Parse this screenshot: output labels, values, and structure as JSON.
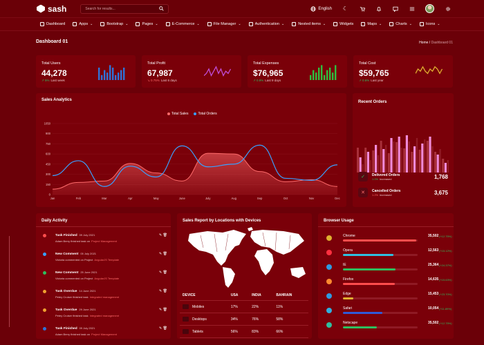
{
  "brand": "sash",
  "search": {
    "placeholder": "Search for results..."
  },
  "topbar": {
    "language": "English"
  },
  "nav": [
    {
      "label": "Dashboard",
      "caret": false
    },
    {
      "label": "Apps",
      "caret": true
    },
    {
      "label": "Bootstrap",
      "caret": true
    },
    {
      "label": "Pages",
      "caret": true
    },
    {
      "label": "E-Commerce",
      "caret": true
    },
    {
      "label": "File Manager",
      "caret": true
    },
    {
      "label": "Authentication",
      "caret": true
    },
    {
      "label": "Nested items",
      "caret": true
    },
    {
      "label": "Widgets",
      "caret": false
    },
    {
      "label": "Maps",
      "caret": true
    },
    {
      "label": "Charts",
      "caret": true
    },
    {
      "label": "Icons",
      "caret": true
    }
  ],
  "page": {
    "title": "Dashboard 01",
    "crumb_home": "Home",
    "crumb_current": "Dashboard 01"
  },
  "stats": [
    {
      "title": "Total Users",
      "value": "44,278",
      "change": "5%",
      "period": "Last week",
      "trend": "up",
      "color": "#2f72d8"
    },
    {
      "title": "Total Profit",
      "value": "67,987",
      "change": "0.75%",
      "period": "Last 6 days",
      "trend": "down",
      "color": "#c04dd8"
    },
    {
      "title": "Total Expenses",
      "value": "$76,965",
      "change": "0.9%",
      "period": "Last 9 days",
      "trend": "up",
      "color": "#2fbf3f"
    },
    {
      "title": "Total Cost",
      "value": "$59,765",
      "change": "0.6%",
      "period": "Last year",
      "trend": "up",
      "color": "#e0b030"
    }
  ],
  "sales_analytics": {
    "title": "Sales Analytics",
    "legend": [
      {
        "name": "Total Sales",
        "color": "#ff6b6b"
      },
      {
        "name": "Total Orders",
        "color": "#3aa0ff"
      }
    ]
  },
  "chart_data": {
    "type": "area",
    "categories": [
      "Jan",
      "Feb",
      "Mar",
      "Apr",
      "May",
      "June",
      "July",
      "Aug",
      "Sep",
      "Oct",
      "Nov",
      "Dec"
    ],
    "ylim": [
      0,
      1000
    ],
    "yticks": [
      0,
      150,
      300,
      450,
      600,
      750,
      900,
      1050
    ],
    "series": [
      {
        "name": "Total Sales",
        "color": "#ff6b6b",
        "values": [
          80,
          180,
          200,
          460,
          320,
          200,
          610,
          600,
          340,
          190,
          220,
          120
        ]
      },
      {
        "name": "Total Orders",
        "color": "#3aa0ff",
        "values": [
          280,
          500,
          120,
          420,
          260,
          720,
          410,
          450,
          730,
          240,
          210,
          440
        ]
      }
    ]
  },
  "recent_orders": {
    "title": "Recent Orders",
    "items": [
      {
        "title": "Delivered Orders",
        "change": "1.0%",
        "note": "increased",
        "value": "1,768",
        "icon": "✓",
        "color": "#2fbf5f"
      },
      {
        "title": "Cancelled Orders",
        "change": "1.2%",
        "note": "increased",
        "value": "3,675",
        "icon": "✕",
        "color": "#ff6b6b"
      }
    ]
  },
  "daily_activity": {
    "title": "Daily Activity",
    "items": [
      {
        "title": "Task Finished",
        "date": "09 July 2021",
        "desc": "Adam Berry finished task on",
        "link": "Project Management",
        "color": "#ff4d4d"
      },
      {
        "title": "New Comment",
        "date": "05 July 2021",
        "desc": "Victoria commented on Project",
        "link": "AngularJS Template",
        "color": "#3aa0ff"
      },
      {
        "title": "New Comment",
        "date": "25 June 2021",
        "desc": "Victoria commented on Project",
        "link": "AngularJS Template",
        "color": "#2fbf5f"
      },
      {
        "title": "Task Overdue",
        "date": "14 June 2021",
        "desc": "Petey Cruiser finished task",
        "link": "Integrated management",
        "color": "#f0a030"
      },
      {
        "title": "Task Overdue",
        "date": "29 June 2021",
        "desc": "Petey Cruiser finished task",
        "link": "Integrated management",
        "color": "#f0a030"
      },
      {
        "title": "Task Finished",
        "date": "09 July 2021",
        "desc": "Adam Berry finished task on",
        "link": "Project Management",
        "color": "#2f72d8"
      }
    ]
  },
  "sales_report": {
    "title": "Sales Report by Locations with Devices",
    "columns": [
      "DEVICE",
      "USA",
      "INDIA",
      "BAHRAIN"
    ],
    "rows": [
      {
        "device": "Mobiles",
        "usa": "17%",
        "india": "22%",
        "bahrain": "11%"
      },
      {
        "device": "Desktops",
        "usa": "34%",
        "india": "76%",
        "bahrain": "58%"
      },
      {
        "device": "Tablets",
        "usa": "56%",
        "india": "83%",
        "bahrain": "66%"
      }
    ]
  },
  "browser_usage": {
    "title": "Browser Usage",
    "items": [
      {
        "name": "Chrome",
        "value": "35,502",
        "pct": "(+12.75%)",
        "share": 0.98,
        "color": "#ff4d4d",
        "icon": "#e0b030"
      },
      {
        "name": "Opera",
        "value": "12,563",
        "pct": "(+15.12%)",
        "share": 0.68,
        "color": "#2fbfe0",
        "icon": "#ff3040"
      },
      {
        "name": "IE",
        "value": "25,364",
        "pct": "(+24.37%)",
        "share": 0.7,
        "color": "#2fbf5f",
        "icon": "#2f9ae0"
      },
      {
        "name": "Firefox",
        "value": "14,635",
        "pct": "(+15.63%)",
        "share": 0.69,
        "color": "#ff4d4d",
        "icon": "#ff8a30"
      },
      {
        "name": "Edge",
        "value": "15,453",
        "pct": "(+23.70%)",
        "share": 0.14,
        "color": "#e0b030",
        "icon": "#2f9ae0"
      },
      {
        "name": "Safari",
        "value": "10,054",
        "pct": "(+11.89%)",
        "share": 0.53,
        "color": "#2f5ad8",
        "icon": "#2fb0e0"
      },
      {
        "name": "Netscape",
        "value": "35,502",
        "pct": "(+12.75%)",
        "share": 0.45,
        "color": "#2fbf5f",
        "icon": "#2fbf9f"
      }
    ]
  }
}
